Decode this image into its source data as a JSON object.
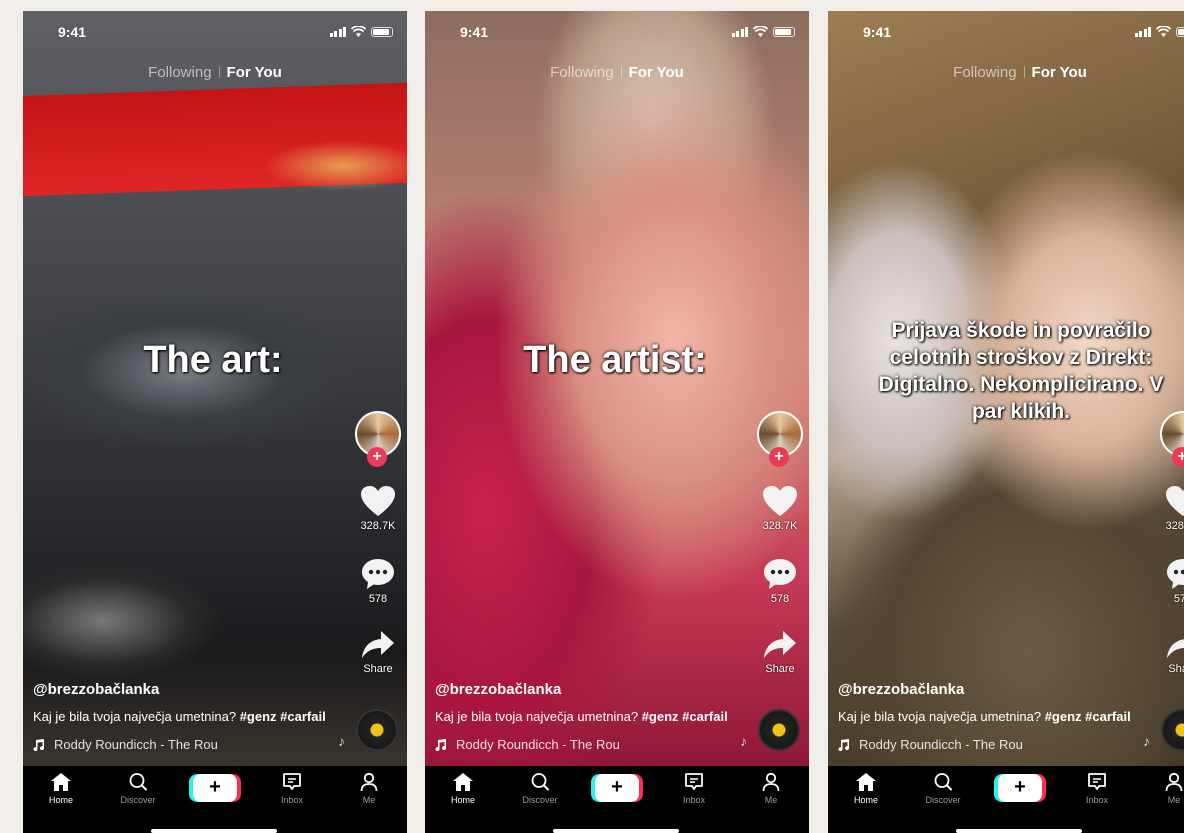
{
  "status": {
    "time": "9:41"
  },
  "feed_tabs": {
    "following": "Following",
    "for_you": "For You"
  },
  "screens": [
    {
      "caption": "The art:"
    },
    {
      "caption": "The artist:"
    },
    {
      "caption": "Prijava škode in povračilo celotnih stroškov z Direkt: Digitalno. Nekomplicirano. V par klikih."
    }
  ],
  "post": {
    "username": "@brezzobačlanka",
    "description": "Kaj je bila tvoja največja umetnina?",
    "hashtags": "#genz #carfail",
    "music": "Roddy Roundicch - The Rou",
    "likes": "328.7K",
    "comments": "578",
    "share_label": "Share"
  },
  "icons": {
    "follow": "plus-icon",
    "like": "heart-icon",
    "comment": "comment-bubble-icon",
    "share": "share-arrow-icon",
    "music": "music-note-icon"
  },
  "nav": {
    "home": "Home",
    "discover": "Discover",
    "create": "+",
    "inbox": "Inbox",
    "me": "Me"
  },
  "colors": {
    "accent_red": "#ea3a55",
    "create_cyan": "#25f4ee",
    "create_pink": "#fe2c55",
    "disc_yellow": "#f2c21a"
  }
}
